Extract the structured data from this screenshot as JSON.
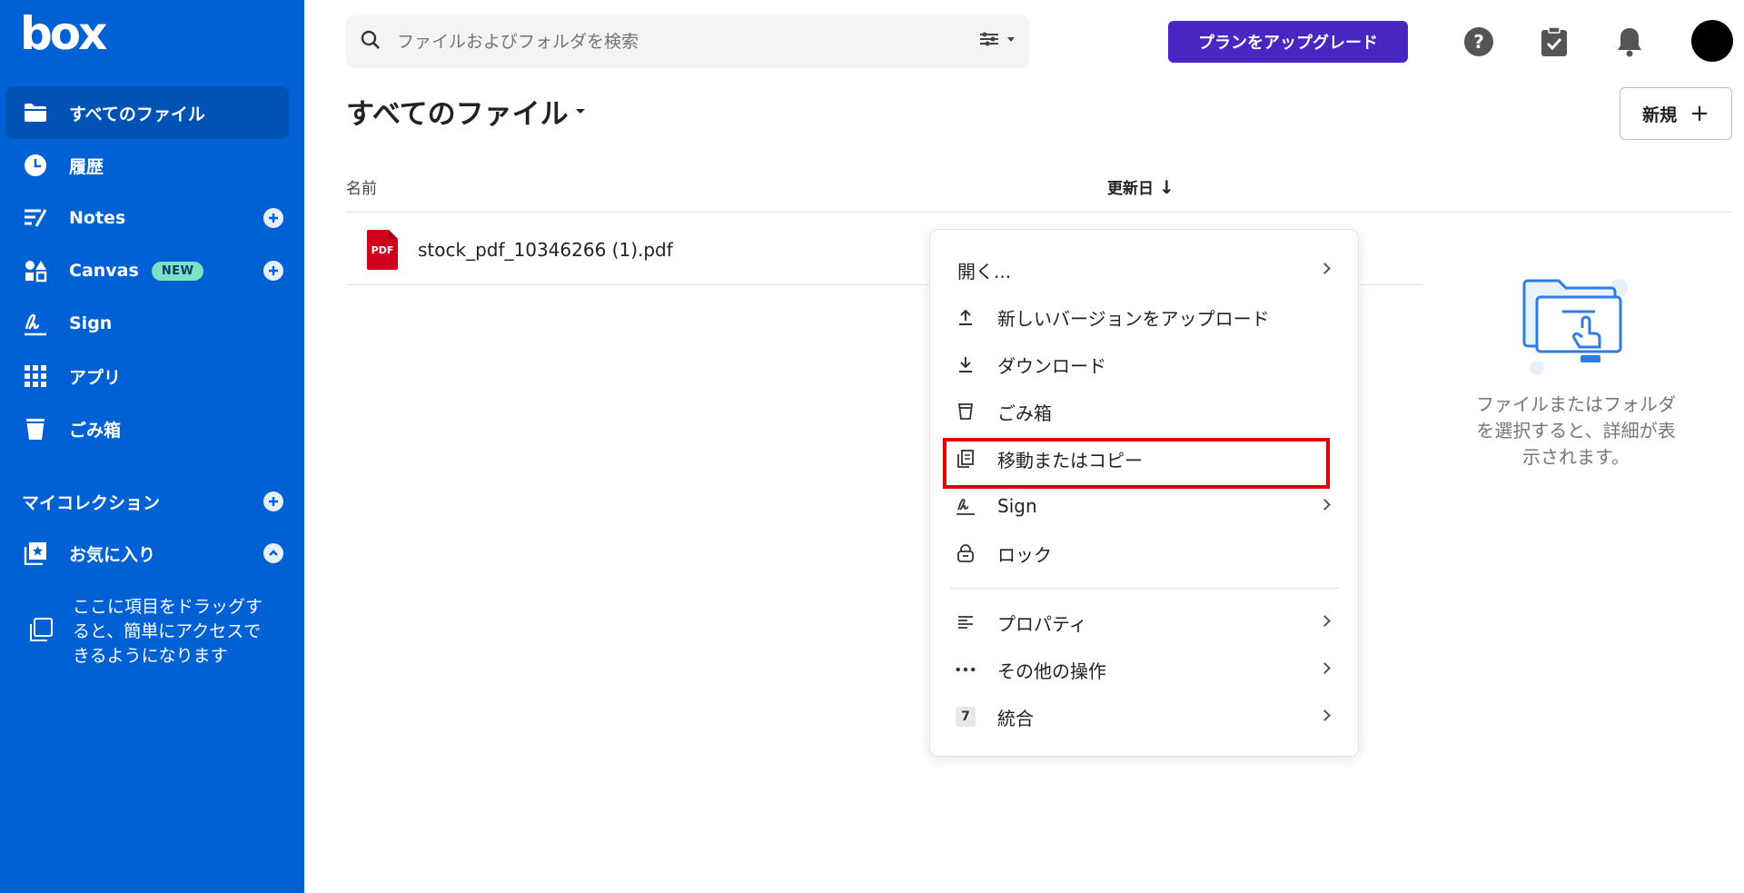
{
  "app": {
    "logo": "box"
  },
  "sidebar": {
    "items": [
      {
        "label": "すべてのファイル",
        "icon": "folder-icon",
        "active": true
      },
      {
        "label": "履歴",
        "icon": "clock-icon"
      },
      {
        "label": "Notes",
        "icon": "notes-icon",
        "plus": true
      },
      {
        "label": "Canvas",
        "icon": "canvas-icon",
        "badge": "NEW",
        "plus": true
      },
      {
        "label": "Sign",
        "icon": "signature-icon"
      },
      {
        "label": "アプリ",
        "icon": "apps-grid-icon"
      },
      {
        "label": "ごみ箱",
        "icon": "trash-icon"
      }
    ],
    "collections_title": "マイコレクション",
    "favorites_label": "お気に入り",
    "drop_hint": "ここに項目をドラッグすると、簡単にアクセスできるようになります"
  },
  "search": {
    "placeholder": "ファイルおよびフォルダを検索"
  },
  "header": {
    "upgrade_label": "プランをアップグレード",
    "page_title": "すべてのファイル",
    "new_label": "新規",
    "new_plus": "+"
  },
  "table": {
    "col_name": "名前",
    "col_modified": "更新日",
    "sort_arrow": "↓",
    "rows": [
      {
        "name": "stock_pdf_10346266 (1).pdf",
        "icon": "pdf-file-icon",
        "icon_text": "PDF"
      }
    ]
  },
  "details": {
    "empty_text": "ファイルまたはフォルダを選択すると、詳細が表示されます。"
  },
  "context_menu": {
    "items": [
      {
        "label": "開く...",
        "icon": "",
        "submenu": true
      },
      {
        "label": "新しいバージョンをアップロード",
        "icon": "upload-icon"
      },
      {
        "label": "ダウンロード",
        "icon": "download-icon"
      },
      {
        "label": "ごみ箱",
        "icon": "trash-icon"
      },
      {
        "label": "移動またはコピー",
        "icon": "copy-icon",
        "highlighted": true
      },
      {
        "label": "Sign",
        "icon": "signature-icon",
        "submenu": true
      },
      {
        "label": "ロック",
        "icon": "lock-icon"
      },
      {
        "label": "プロパティ",
        "icon": "properties-icon",
        "submenu": true
      },
      {
        "label": "その他の操作",
        "icon": "more-icon",
        "submenu": true
      },
      {
        "label": "統合",
        "icon": "integration-badge",
        "badge": "7",
        "submenu": true
      }
    ]
  },
  "colors": {
    "sidebar": "#0061d5",
    "upgrade": "#4826c2",
    "highlight": "#e00000",
    "pdf": "#d0021b"
  }
}
